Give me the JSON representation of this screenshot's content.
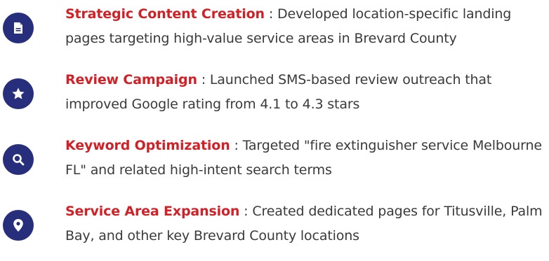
{
  "colors": {
    "accent_red": "#d22027",
    "icon_navy": "#272f7c",
    "body_text": "#3a3a3a"
  },
  "items": [
    {
      "icon": "document-icon",
      "title": "Strategic Content Creation",
      "separator": " : ",
      "description": "Developed location-specific landing pages targeting high-value service areas in Brevard County"
    },
    {
      "icon": "star-icon",
      "title": "Review Campaign",
      "separator": " : ",
      "description": "Launched SMS-based review outreach that improved Google rating from 4.1 to 4.3 stars"
    },
    {
      "icon": "search-icon",
      "title": "Keyword Optimization",
      "separator": " : ",
      "description": "Targeted \"fire extinguisher service Melbourne FL\" and related high-intent search terms"
    },
    {
      "icon": "map-pin-icon",
      "title": "Service Area Expansion",
      "separator": " : ",
      "description": "Created dedicated pages for Titusville, Palm Bay, and other key Brevard County locations"
    }
  ]
}
